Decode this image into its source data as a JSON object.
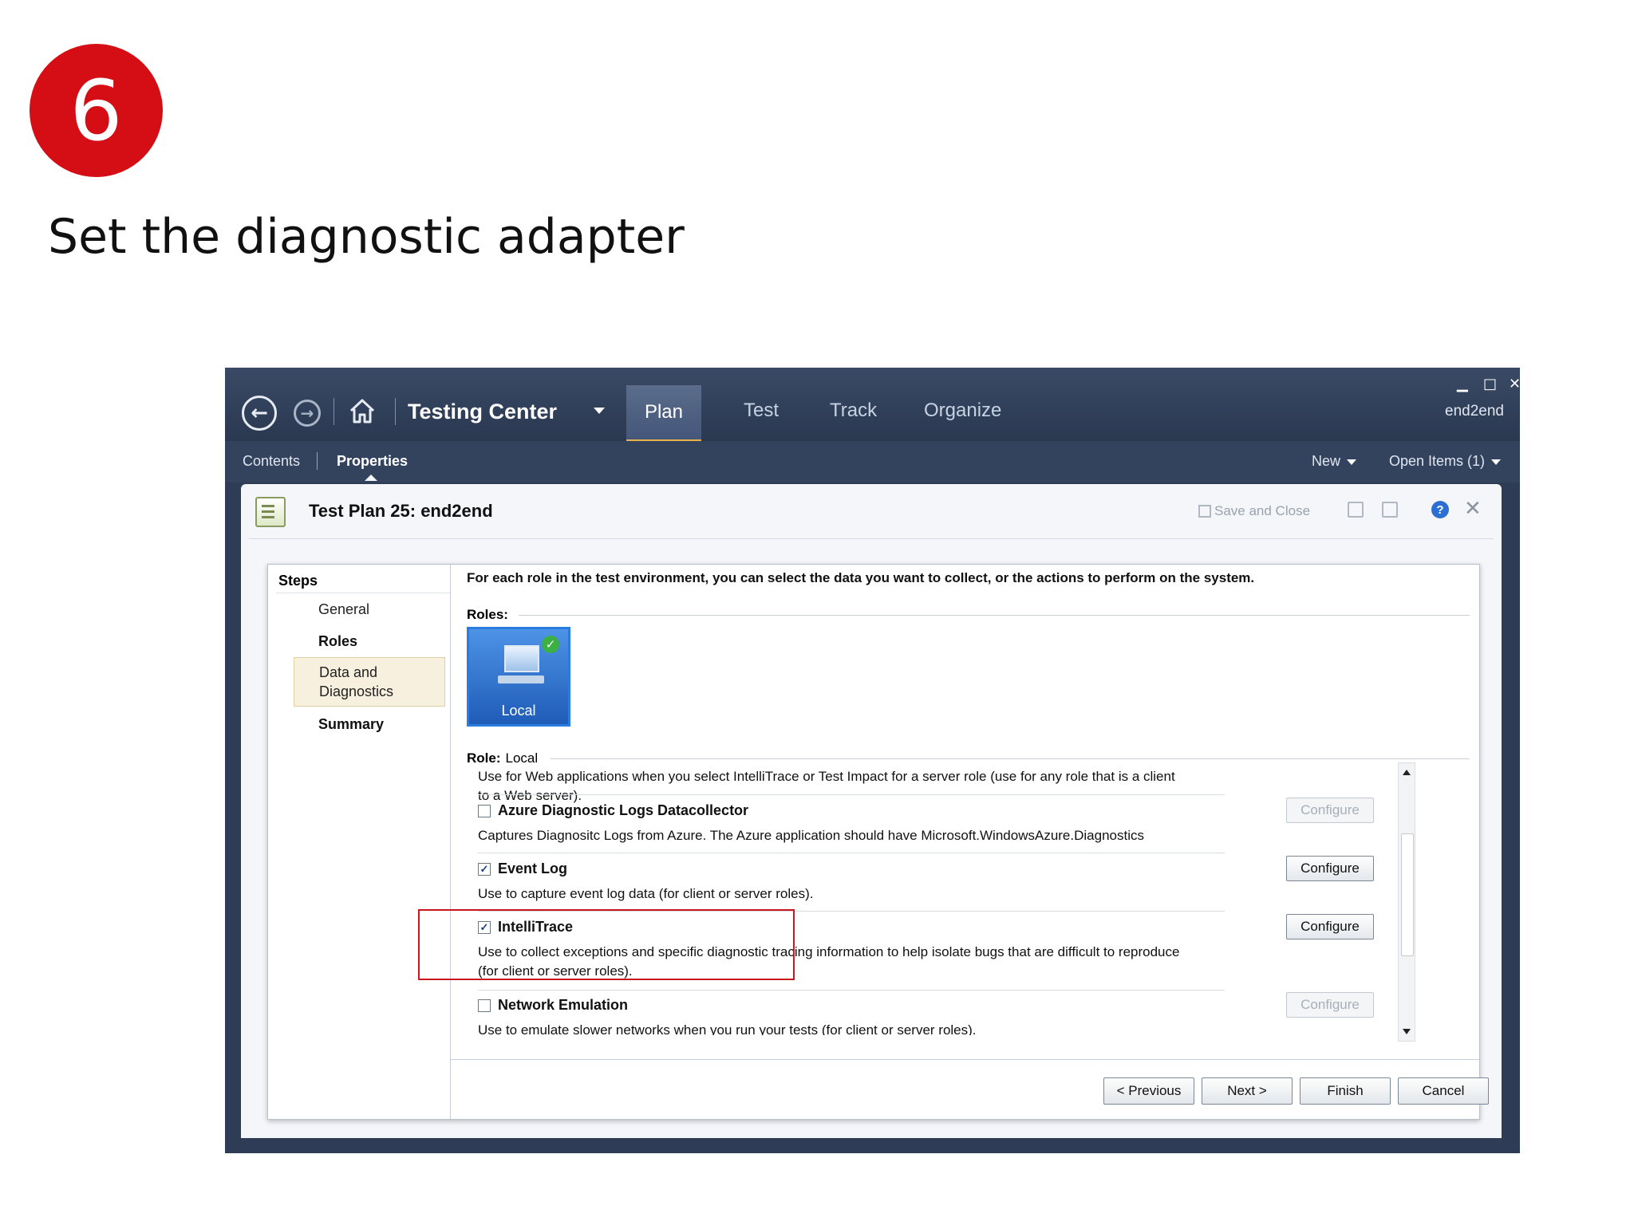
{
  "slide": {
    "step_number": "6",
    "title": "Set the diagnostic adapter"
  },
  "app": {
    "title": "Testing Center",
    "tabs": [
      {
        "label": "Plan",
        "active": true
      },
      {
        "label": "Test",
        "active": false
      },
      {
        "label": "Track",
        "active": false
      },
      {
        "label": "Organize",
        "active": false
      }
    ],
    "user": "end2end",
    "subnav": {
      "contents": "Contents",
      "properties": "Properties",
      "new": "New",
      "open_items": "Open Items (1)"
    }
  },
  "document": {
    "title": "Test Plan 25: end2end",
    "save_close": "Save and Close"
  },
  "wizard": {
    "steps_title": "Steps",
    "steps": [
      {
        "label": "General",
        "bold": false
      },
      {
        "label": "Roles",
        "bold": true
      },
      {
        "label": "Data and Diagnostics",
        "bold": false,
        "selected": true
      },
      {
        "label": "Summary",
        "bold": true
      }
    ],
    "intro": "For each role in the test environment, you can select the data you want to collect, or the actions to perform on the system.",
    "roles_label": "Roles:",
    "role_tile": "Local",
    "role_label": "Role:",
    "role_value": "Local",
    "web_note": "Use for Web applications when you select IntelliTrace or Test Impact for a server role (use for any role that is a client to a Web server).",
    "adapters": [
      {
        "name": "Azure Diagnostic Logs Datacollector",
        "checked": false,
        "description": "Captures Diagnositc Logs from Azure. The Azure application should have Microsoft.WindowsAzure.Diagnostics",
        "configure_enabled": false
      },
      {
        "name": "Event Log",
        "checked": true,
        "description": "Use to capture event log data (for client or server roles).",
        "configure_enabled": true
      },
      {
        "name": "IntelliTrace",
        "checked": true,
        "description": "Use to collect exceptions and specific diagnostic tracing information to help isolate bugs that are difficult to reproduce (for client or server roles).",
        "configure_enabled": true,
        "highlighted": true
      },
      {
        "name": "Network Emulation",
        "checked": false,
        "description": "Use to emulate slower networks when you run your tests (for client or server roles).",
        "configure_enabled": false
      }
    ],
    "configure_label": "Configure",
    "buttons": {
      "previous": "< Previous",
      "next": "Next >",
      "finish": "Finish",
      "cancel": "Cancel"
    }
  },
  "icons": {
    "check": "✓",
    "close": "✕",
    "minimize": "▁",
    "maximize": "□",
    "help": "?"
  },
  "colors": {
    "badge": "#d40e14",
    "header_bg": "#2e3c55",
    "highlight_box": "#c8161d",
    "active_tab_underline": "#e7b24a"
  }
}
